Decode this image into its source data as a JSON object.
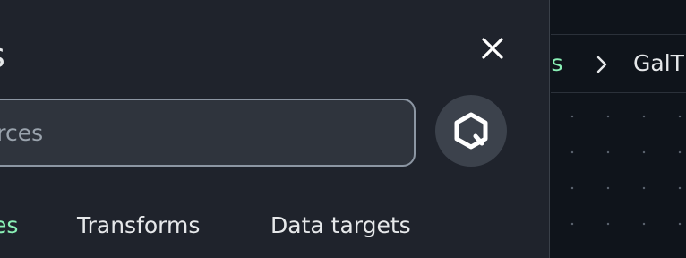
{
  "panel": {
    "title": "s",
    "search": {
      "placeholder": "h data sources"
    },
    "tabs": [
      {
        "label": "es",
        "active": true
      },
      {
        "label": "Transforms",
        "active": false
      },
      {
        "label": "Data targets",
        "active": false
      }
    ],
    "icons": {
      "close": "close-icon",
      "action": "hexagon-search-icon"
    }
  },
  "breadcrumb": {
    "link_label": "ws",
    "separator": "chevron-right-icon",
    "current_label": "GalT"
  },
  "colors": {
    "panel_bg": "#1f232c",
    "accent": "#8af0b6",
    "text": "#e6e8ea",
    "canvas_bg": "#0f141b"
  }
}
